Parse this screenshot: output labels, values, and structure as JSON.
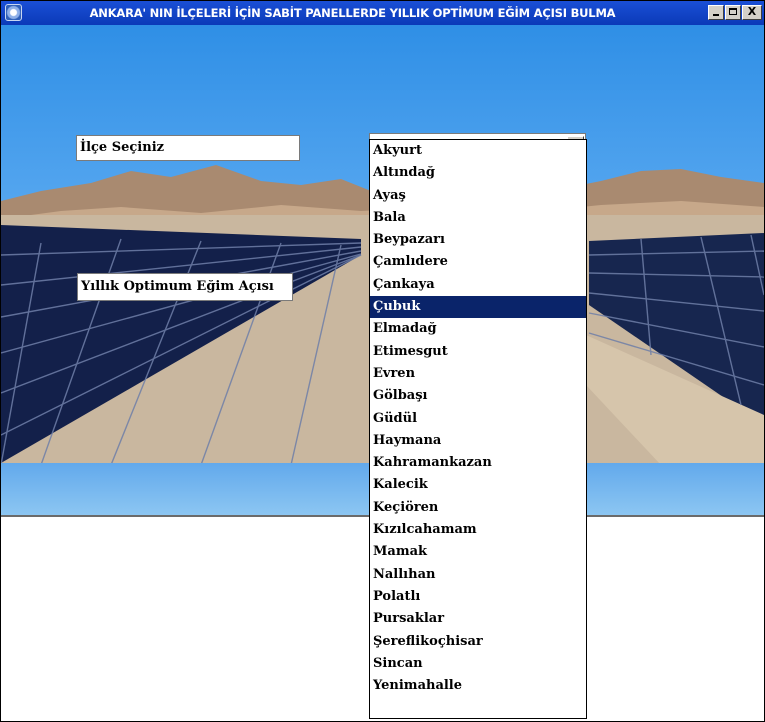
{
  "window": {
    "title": "ANKARA' NIN İLÇELERİ İÇİN SABİT PANELLERDE YILLIK OPTİMUM EĞİM AÇISI BULMA",
    "controls": {
      "minimize": "_",
      "maximize": "□",
      "close": "X"
    }
  },
  "form": {
    "district_label": "İlçe Seçiniz",
    "angle_label": "Yıllık Optimum Eğim Açısı",
    "district_combo_value": ""
  },
  "dropdown": {
    "selected_index": 7,
    "items": [
      "Akyurt",
      "Altındağ",
      "Ayaş",
      "Bala",
      "Beypazarı",
      "Çamlıdere",
      "Çankaya",
      "Çubuk",
      "Elmadağ",
      "Etimesgut",
      "Evren",
      "Gölbaşı",
      "Güdül",
      "Haymana",
      "Kahramankazan",
      "Kalecik",
      "Keçiören",
      "Kızılcahamam",
      "Mamak",
      "Nallıhan",
      "Polatlı",
      "Pursaklar",
      "Şereflikoçhisar",
      "Sincan",
      "Yenimahalle"
    ]
  },
  "colors": {
    "titlebar": "#0b3ab8",
    "selection": "#0a246a",
    "sky": "#58a8f0"
  },
  "icons": {
    "app": "solar-app-icon",
    "combo_button": "chevron-down-icon"
  }
}
